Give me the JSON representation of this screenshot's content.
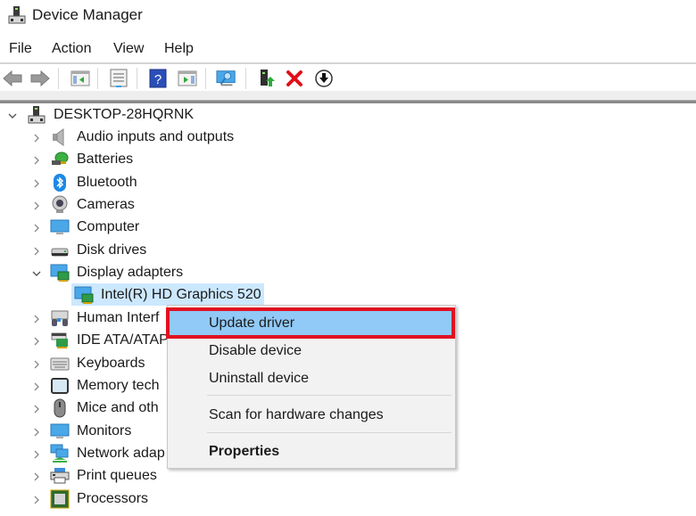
{
  "window": {
    "title": "Device Manager",
    "icon": "device-manager-icon"
  },
  "menubar": {
    "items": [
      {
        "label": "File"
      },
      {
        "label": "Action"
      },
      {
        "label": "View"
      },
      {
        "label": "Help"
      }
    ]
  },
  "toolbar": {
    "buttons": [
      {
        "name": "back",
        "icon": "arrow-left-icon"
      },
      {
        "name": "forward",
        "icon": "arrow-right-icon"
      },
      {
        "name": "show-hide-console-tree",
        "icon": "console-tree-icon"
      },
      {
        "name": "properties",
        "icon": "properties-icon"
      },
      {
        "name": "help",
        "icon": "help-icon"
      },
      {
        "name": "show-hide-action-pane",
        "icon": "action-pane-icon"
      },
      {
        "name": "scan-hardware",
        "icon": "monitor-scan-icon"
      },
      {
        "name": "update-driver",
        "icon": "update-driver-icon"
      },
      {
        "name": "uninstall-device",
        "icon": "red-x-icon"
      },
      {
        "name": "disable-device",
        "icon": "down-arrow-circle-icon"
      }
    ]
  },
  "tree": {
    "root": {
      "label": "DESKTOP-28HQRNK",
      "expanded": true,
      "icon": "computer-tower-icon"
    },
    "categories": [
      {
        "label": "Audio inputs and outputs",
        "icon": "speaker-icon",
        "expanded": false
      },
      {
        "label": "Batteries",
        "icon": "battery-plug-icon",
        "expanded": false
      },
      {
        "label": "Bluetooth",
        "icon": "bluetooth-icon",
        "expanded": false
      },
      {
        "label": "Cameras",
        "icon": "webcam-icon",
        "expanded": false
      },
      {
        "label": "Computer",
        "icon": "monitor-icon",
        "expanded": false
      },
      {
        "label": "Disk drives",
        "icon": "disk-drive-icon",
        "expanded": false
      },
      {
        "label": "Display adapters",
        "icon": "display-adapter-icon",
        "expanded": true,
        "children": [
          {
            "label": "Intel(R) HD Graphics 520",
            "icon": "display-adapter-icon",
            "selected": true
          }
        ]
      },
      {
        "label": "Human Interf",
        "icon": "hid-icon",
        "expanded": false
      },
      {
        "label": "IDE ATA/ATAPI",
        "icon": "ide-controller-icon",
        "expanded": false
      },
      {
        "label": "Keyboards",
        "icon": "keyboard-icon",
        "expanded": false
      },
      {
        "label": "Memory tech",
        "icon": "memory-icon",
        "expanded": false
      },
      {
        "label": "Mice and oth",
        "icon": "mouse-icon",
        "expanded": false
      },
      {
        "label": "Monitors",
        "icon": "monitor-icon",
        "expanded": false
      },
      {
        "label": "Network adap",
        "icon": "network-icon",
        "expanded": false
      },
      {
        "label": "Print queues",
        "icon": "printer-icon",
        "expanded": false
      },
      {
        "label": "Processors",
        "icon": "processor-icon",
        "expanded": false
      }
    ]
  },
  "context_menu": {
    "items": [
      {
        "label": "Update driver",
        "highlighted": true
      },
      {
        "label": "Disable device"
      },
      {
        "label": "Uninstall device"
      },
      {
        "separator": true
      },
      {
        "label": "Scan for hardware changes"
      },
      {
        "separator": true
      },
      {
        "label": "Properties",
        "bold": true
      }
    ],
    "callout_color": "#e01020",
    "highlight_color": "#91c9f7"
  },
  "colors": {
    "selection": "#cce8ff",
    "menu_bg": "#f2f2f2"
  }
}
